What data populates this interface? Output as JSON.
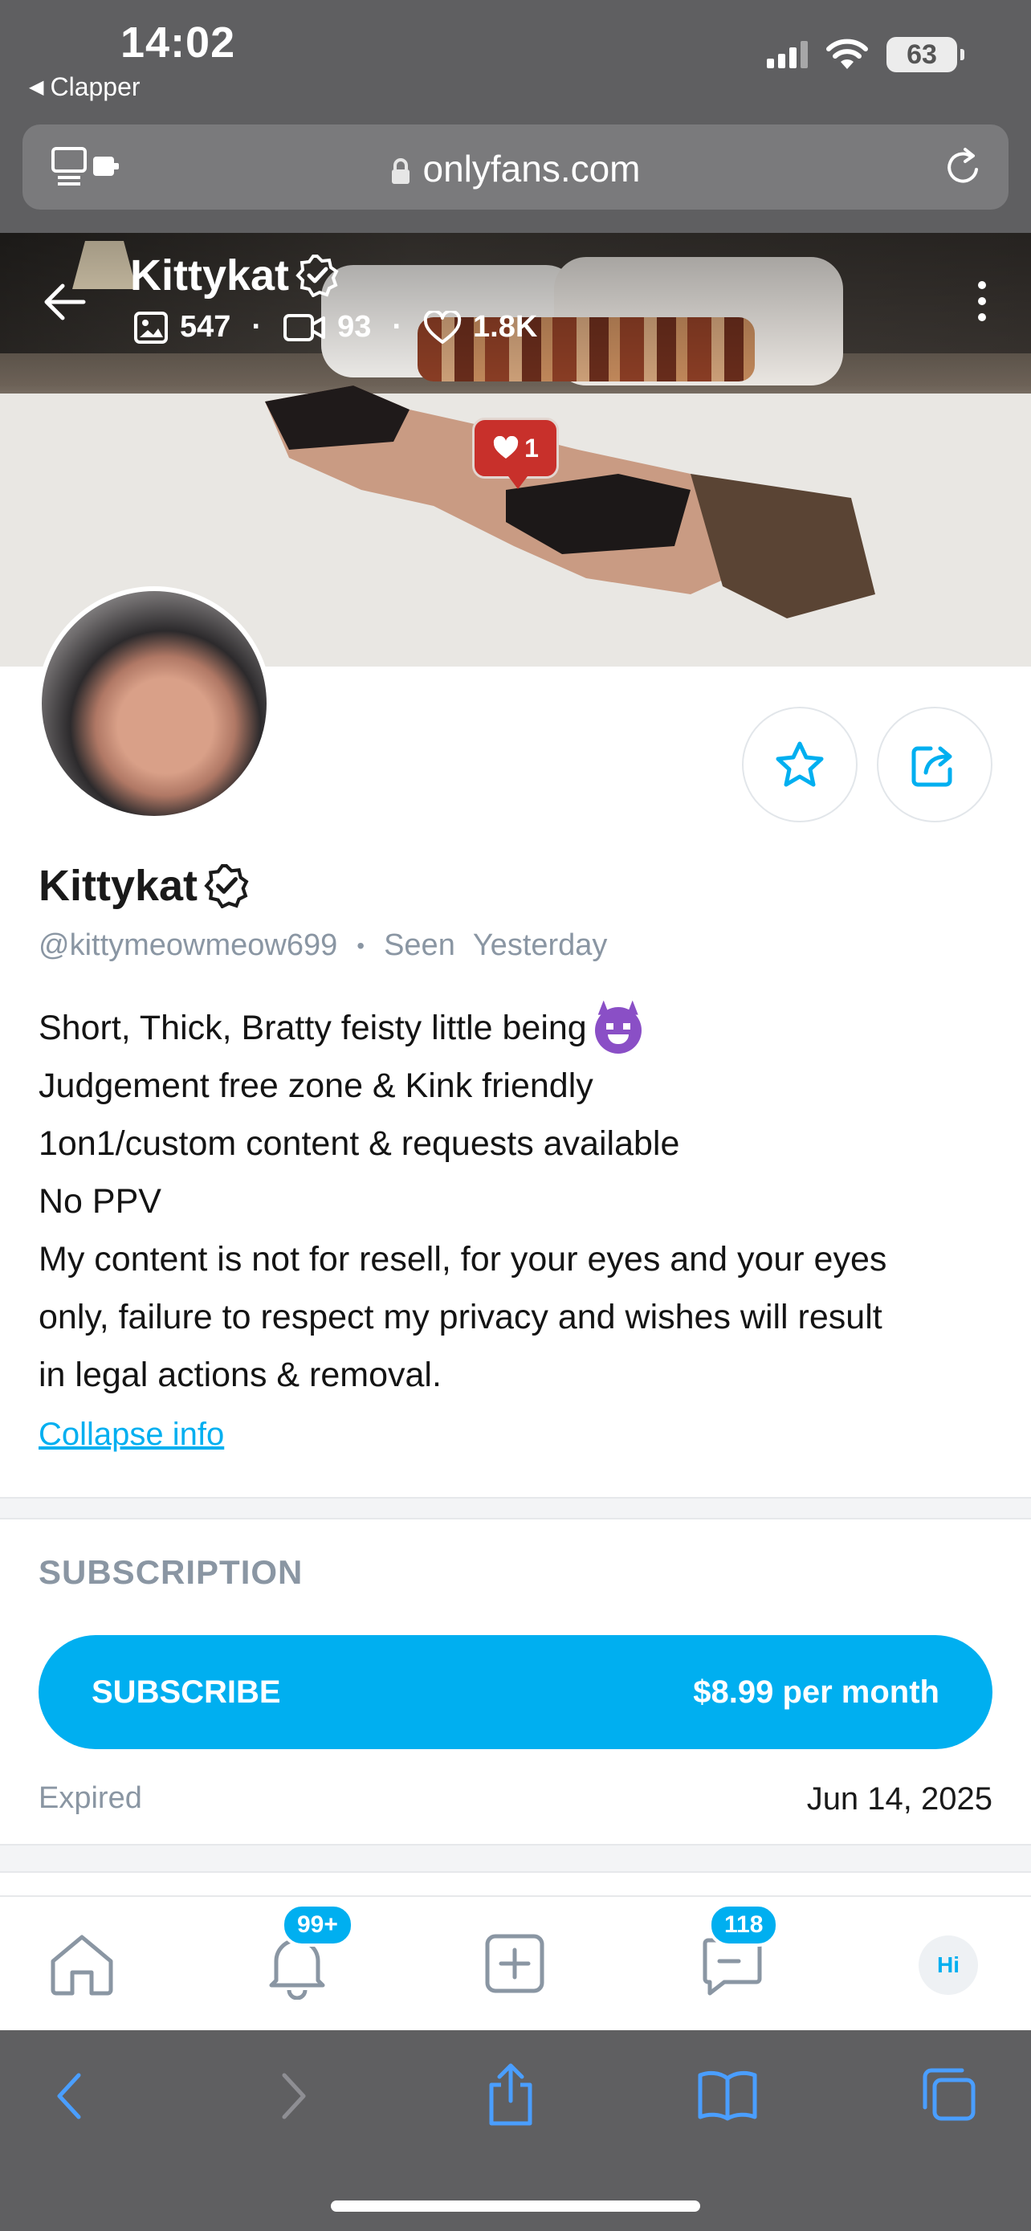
{
  "status_bar": {
    "time": "14:02",
    "back_app": "Clapper",
    "battery": "63"
  },
  "browser": {
    "url": "onlyfans.com"
  },
  "cover": {
    "name": "Kittykat",
    "stats": {
      "photos": "547",
      "videos": "93",
      "likes": "1.8K"
    },
    "like_badge": "1"
  },
  "profile": {
    "name": "Kittykat",
    "handle": "@kittymeowmeow699",
    "seen_label": "Seen",
    "seen_value": "Yesterday",
    "bio_lines": [
      "Short, Thick, Bratty feisty little being",
      "Judgement free zone & Kink friendly",
      "1on1/custom content & requests available",
      "No PPV",
      "My content is not for resell, for your eyes and your eyes",
      "only, failure to respect my privacy and wishes will result",
      "in legal actions & removal."
    ],
    "collapse_label": "Collapse info"
  },
  "subscription": {
    "heading": "SUBSCRIPTION",
    "button_label": "SUBSCRIBE",
    "price": "$8.99 per month",
    "status_label": "Expired",
    "status_date": "Jun 14, 2025"
  },
  "app_nav": {
    "notifications_badge": "99+",
    "messages_badge": "118",
    "avatar_initials": "Hi"
  },
  "colors": {
    "accent": "#00aff0",
    "meta_gray": "#8a96a3",
    "safari_bar": "#5f5f61",
    "like_red": "#c8302b"
  }
}
